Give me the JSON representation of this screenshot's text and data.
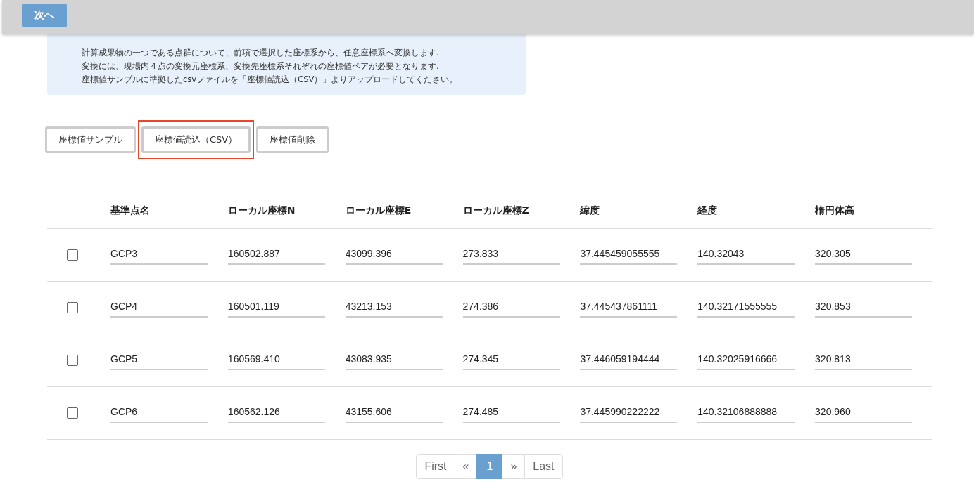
{
  "top_bar": {
    "next_button": "次へ"
  },
  "alert": {
    "lines": [
      "計算成果物の一つである点群について、前項で選択した座標系から、任意座標系へ変換します.",
      "変換には、現場内４点の変換元座標系、変換先座標系それぞれの座標値ペアが必要となります.",
      "座標値サンプルに準拠したcsvファイルを「座標値読込（CSV）」よりアップロードしてください。"
    ]
  },
  "actions": [
    {
      "label": "座標値サンプル",
      "highlighted": false
    },
    {
      "label": "座標値読込（CSV）",
      "highlighted": true
    },
    {
      "label": "座標値削除",
      "highlighted": false
    }
  ],
  "table": {
    "columns": [
      "基準点名",
      "ローカル座標N",
      "ローカル座標E",
      "ローカル座標Z",
      "緯度",
      "経度",
      "楕円体高"
    ],
    "rows": [
      {
        "checked": false,
        "cells": [
          "GCP3",
          "160502.887",
          "43099.396",
          "273.833",
          "37.445459055555",
          "140.32043",
          "320.305"
        ]
      },
      {
        "checked": false,
        "cells": [
          "GCP4",
          "160501.119",
          "43213.153",
          "274.386",
          "37.445437861111",
          "140.32171555555",
          "320.853"
        ]
      },
      {
        "checked": false,
        "cells": [
          "GCP5",
          "160569.410",
          "43083.935",
          "274.345",
          "37.446059194444",
          "140.32025916666",
          "320.813"
        ]
      },
      {
        "checked": false,
        "cells": [
          "GCP6",
          "160562.126",
          "43155.606",
          "274.485",
          "37.445990222222",
          "140.32106888888",
          "320.960"
        ]
      }
    ]
  },
  "pagination": [
    {
      "label": "First",
      "selected": false
    },
    {
      "label": "«",
      "selected": false
    },
    {
      "label": "1",
      "selected": true
    },
    {
      "label": "»",
      "selected": false
    },
    {
      "label": "Last",
      "selected": false
    }
  ]
}
